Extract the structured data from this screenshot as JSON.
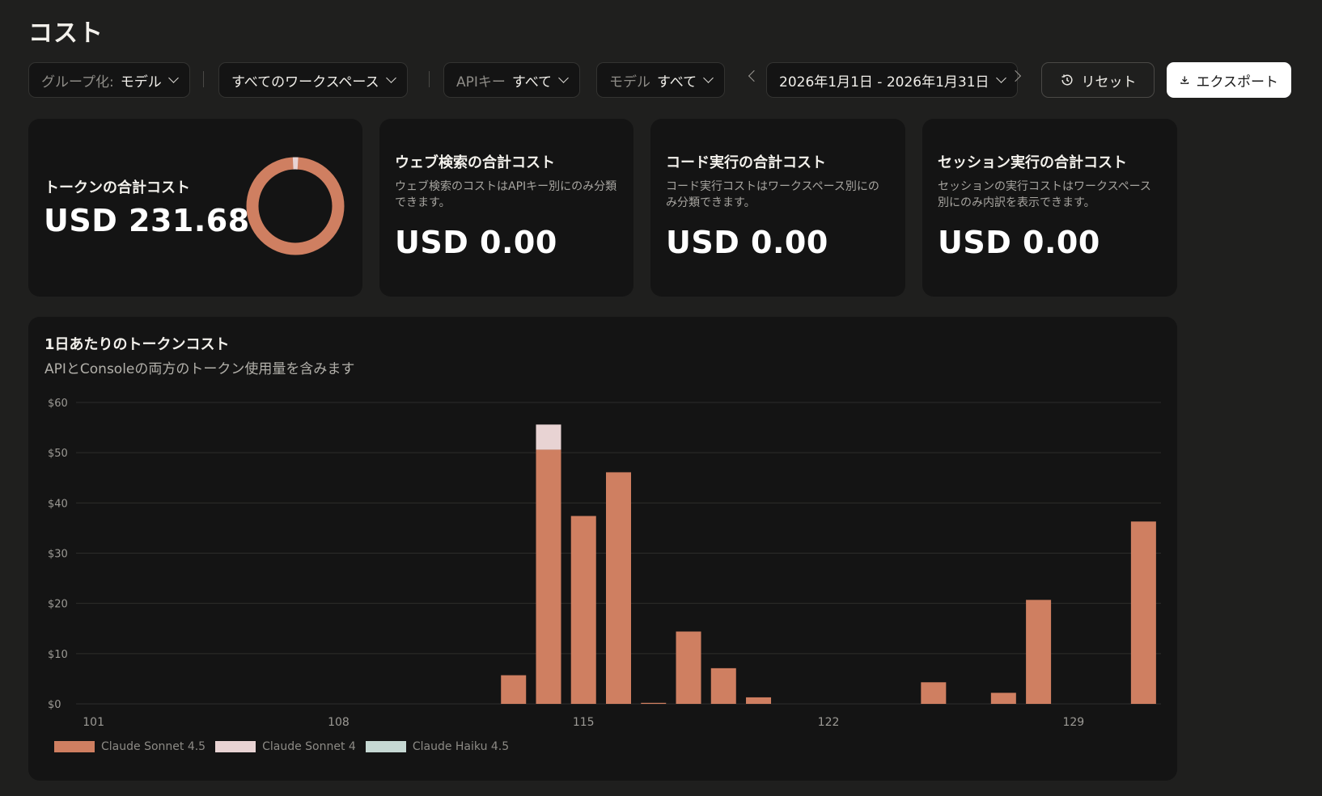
{
  "page": {
    "title": "コスト"
  },
  "filters": {
    "group_by_label": "グループ化:",
    "group_by_value": "モデル",
    "workspace": "すべてのワークスペース",
    "api_key_label": "APIキー",
    "api_key_value": "すべて",
    "model_label": "モデル",
    "model_value": "すべて",
    "date_range": "2026年1月1日 - 2026年1月31日",
    "reset_label": "リセット",
    "export_label": "エクスポート"
  },
  "cards": {
    "tokens": {
      "title": "トークンの合計コスト",
      "amount": "USD 231.68"
    },
    "web_search": {
      "title": "ウェブ検索の合計コスト",
      "desc": "ウェブ検索のコストはAPIキー別にのみ分類できます。",
      "amount": "USD 0.00"
    },
    "code_exec": {
      "title": "コード実行の合計コスト",
      "desc": "コード実行コストはワークスペース別にのみ分類できます。",
      "amount": "USD 0.00"
    },
    "session_exec": {
      "title": "セッション実行の合計コスト",
      "desc": "セッションの実行コストはワークスペース別にのみ内訳を表示できます。",
      "amount": "USD 0.00"
    }
  },
  "chart": {
    "title": "1日あたりのトークンコスト",
    "subtitle": "APIとConsoleの両方のトークン使用量を含みます"
  },
  "colors": {
    "sonnet45": "#cf7f61",
    "sonnet4": "#e8d3d3",
    "haiku45": "#c6d8d3",
    "grid": "#2d2d2b"
  },
  "chart_data": {
    "type": "bar",
    "stacked": true,
    "x": [
      101,
      102,
      103,
      104,
      105,
      106,
      107,
      108,
      109,
      110,
      111,
      112,
      113,
      114,
      115,
      116,
      117,
      118,
      119,
      120,
      121,
      122,
      123,
      124,
      125,
      126,
      127,
      128,
      129,
      130,
      131
    ],
    "x_ticks": [
      "101",
      "108",
      "115",
      "122",
      "129"
    ],
    "y_ticks": [
      "$0",
      "$10",
      "$20",
      "$30",
      "$40",
      "$50",
      "$60"
    ],
    "ylim": [
      0,
      60
    ],
    "grid": true,
    "legend_position": "bottom-left",
    "series": [
      {
        "name": "Claude Sonnet 4.5",
        "color": "#cf7f61",
        "values": [
          0,
          0,
          0,
          0,
          0,
          0,
          0,
          0,
          0,
          0,
          0,
          0,
          5.7,
          50.6,
          37.4,
          46.1,
          0.2,
          14.4,
          7.1,
          1.3,
          0,
          0,
          0,
          0,
          4.3,
          0,
          2.2,
          20.7,
          0,
          0,
          36.3
        ]
      },
      {
        "name": "Claude Sonnet 4",
        "color": "#e8d3d3",
        "values": [
          0,
          0,
          0,
          0,
          0,
          0,
          0,
          0,
          0,
          0,
          0,
          0,
          0,
          5.0,
          0,
          0,
          0,
          0,
          0,
          0,
          0,
          0,
          0,
          0,
          0,
          0,
          0,
          0,
          0,
          0,
          0
        ]
      },
      {
        "name": "Claude Haiku 4.5",
        "color": "#c6d8d3",
        "values": [
          0,
          0,
          0,
          0,
          0,
          0,
          0,
          0,
          0,
          0,
          0,
          0,
          0,
          0,
          0,
          0,
          0,
          0,
          0,
          0,
          0,
          0,
          0,
          0,
          0,
          0,
          0,
          0,
          0,
          0,
          0
        ]
      }
    ]
  }
}
